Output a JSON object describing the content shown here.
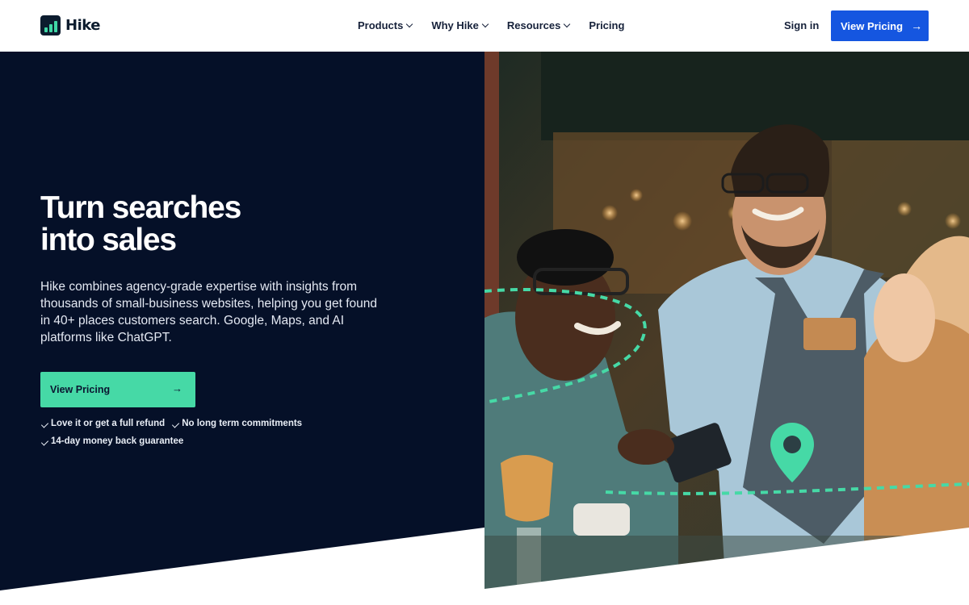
{
  "nav": {
    "brand": "Hike",
    "menu": [
      {
        "label": "Products",
        "dropdown": true
      },
      {
        "label": "Why Hike",
        "dropdown": true
      },
      {
        "label": "Resources",
        "dropdown": true
      },
      {
        "label": "Pricing",
        "dropdown": false
      }
    ],
    "sign_in": "Sign in",
    "cta": "View Pricing"
  },
  "hero": {
    "title_line1": "Turn searches",
    "title_line2": "into sales",
    "lead": "Hike combines agency-grade expertise with insights from thousands of small-business websites, helping you get found in 40+ places customers search. Google, Maps, and AI platforms like ChatGPT.",
    "cta": "View Pricing",
    "checks": [
      "Love it or get a full refund",
      "No long term commitments",
      "14-day money back guarantee"
    ]
  },
  "colors": {
    "dark_bg": "#051028",
    "accent_green": "#46d9a6",
    "brand_blue": "#1556e0"
  },
  "icons": {
    "logo": "bar-chart-logo-icon",
    "dropdown": "chevron-down-icon",
    "arrow": "arrow-right-icon",
    "check": "check-icon",
    "pin": "map-pin-icon"
  }
}
